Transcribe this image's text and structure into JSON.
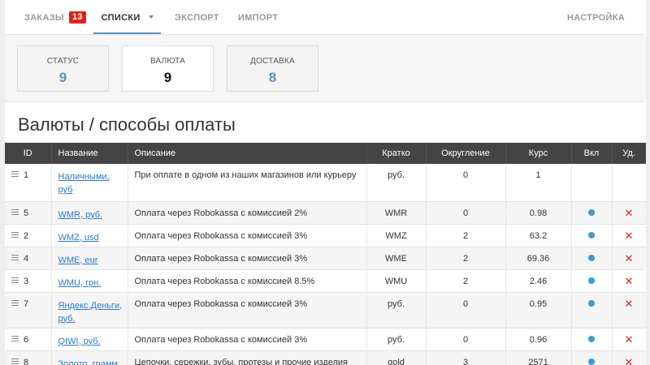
{
  "nav": {
    "orders_label": "ЗАКАЗЫ",
    "orders_count": "13",
    "lists_label": "СПИСКИ",
    "export_label": "ЭКСПОРТ",
    "import_label": "ИМПОРТ",
    "settings_label": "НАСТРОЙКА"
  },
  "stats": [
    {
      "label": "СТАТУС",
      "value": "9"
    },
    {
      "label": "ВАЛЮТА",
      "value": "9"
    },
    {
      "label": "ДОСТАВКА",
      "value": "8"
    }
  ],
  "page_title": "Валюты / способы оплаты",
  "table": {
    "headers": [
      "ID",
      "Название",
      "Описание",
      "Кратко",
      "Округление",
      "Курс",
      "Вкл",
      "Уд."
    ],
    "rows": [
      {
        "id": "1",
        "name_1": "Наличными,",
        "name_2": "руб",
        "desc": "При оплате в одном из наших магазинов или курьеру",
        "short": "руб.",
        "round": "0",
        "rate": "1",
        "enabled": false,
        "deletable": false
      },
      {
        "id": "5",
        "name_1": "WMR, руб.",
        "name_2": "",
        "desc": "Оплата через Robokassa с комиссией 2%",
        "short": "WMR",
        "round": "0",
        "rate": "0.98",
        "enabled": true,
        "deletable": true
      },
      {
        "id": "2",
        "name_1": "WMZ, usd",
        "name_2": "",
        "desc": "Оплата через Robokassa с комиссией 3%",
        "short": "WMZ",
        "round": "2",
        "rate": "63.2",
        "enabled": true,
        "deletable": true
      },
      {
        "id": "4",
        "name_1": "WME, eur",
        "name_2": "",
        "desc": "Оплата через Robokassa с комиссией 3%",
        "short": "WME",
        "round": "2",
        "rate": "69.36",
        "enabled": true,
        "deletable": true
      },
      {
        "id": "3",
        "name_1": "WMU, грн.",
        "name_2": "",
        "desc": "Оплата через Robokassa с комиссией 8.5%",
        "short": "WMU",
        "round": "2",
        "rate": "2.46",
        "enabled": true,
        "deletable": true
      },
      {
        "id": "7",
        "name_1": "Яндекс.Деньги,",
        "name_2": "руб.",
        "desc": "Оплата через Robokassa с комиссией 3%",
        "short": "руб.",
        "round": "0",
        "rate": "0.95",
        "enabled": true,
        "deletable": true
      },
      {
        "id": "6",
        "name_1": "QIWI, руб.",
        "name_2": "",
        "desc": "Оплата через Robokassa с комиссией 3%",
        "short": "руб.",
        "round": "0",
        "rate": "0.96",
        "enabled": true,
        "deletable": true
      },
      {
        "id": "8",
        "name_1": "Золото, грамм",
        "name_2": "",
        "desc": "Цепочки, сережки, зубы, протезы и прочие изделия",
        "short": "gold",
        "round": "3",
        "rate": "2571",
        "enabled": true,
        "deletable": true
      }
    ]
  },
  "colors": {
    "accent": "#5b8fc7",
    "link": "#2a7bd1",
    "badge": "#e0201c",
    "header_bg": "#444444",
    "enabled_dot": "#3a9ad9",
    "delete": "#d9281f"
  },
  "icons": {
    "drag": "drag-handle-icon",
    "enabled": "enabled-dot-icon",
    "delete": "delete-x-icon"
  }
}
